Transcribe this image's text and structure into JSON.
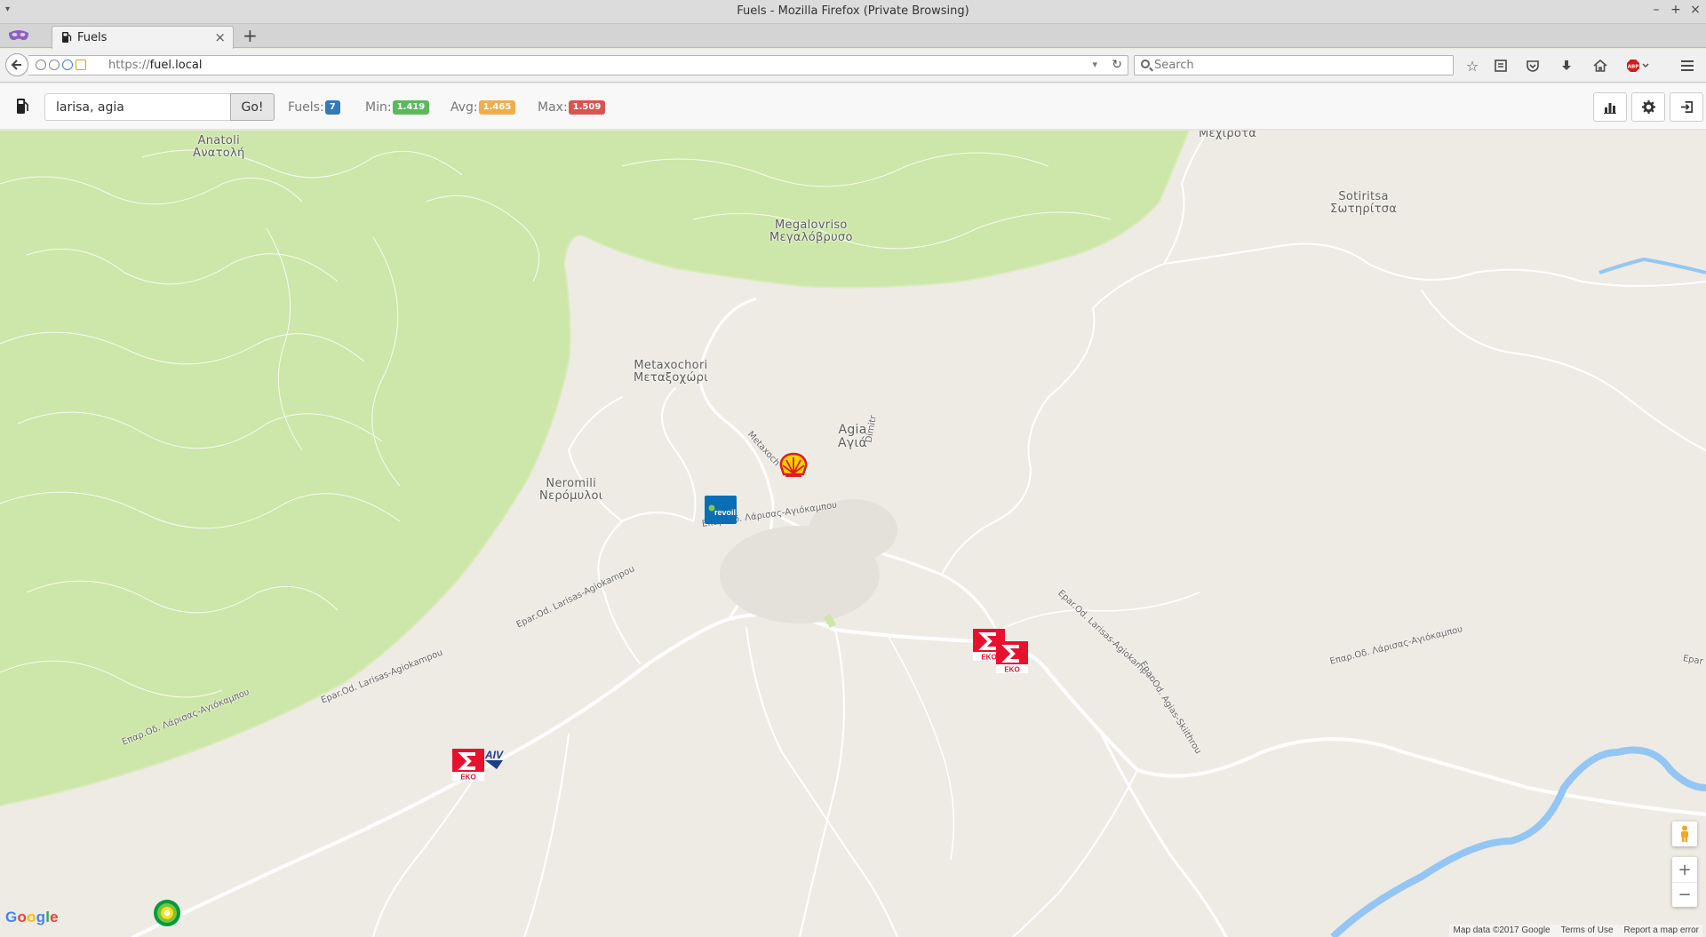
{
  "window": {
    "title": "Fuels - Mozilla Firefox (Private Browsing)"
  },
  "tab": {
    "label": "Fuels",
    "close_glyph": "×",
    "new_tab_glyph": "+"
  },
  "urlbar": {
    "scheme": "https://",
    "host": "fuel.local"
  },
  "searchbar": {
    "placeholder": "Search"
  },
  "app": {
    "location_value": "larisa, agia",
    "go_label": "Go!",
    "stats": {
      "fuels_label": "Fuels:",
      "fuels_count": "7",
      "min_label": "Min:",
      "min_value": "1.419",
      "avg_label": "Avg:",
      "avg_value": "1.465",
      "max_label": "Max:",
      "max_value": "1.509"
    },
    "actions": [
      "bar-chart-icon",
      "gear-icon",
      "sign-out-icon"
    ]
  },
  "map": {
    "places": {
      "mexrota": "Μεχίροτα",
      "anatoli_latin": "Anatoli",
      "anatoli_greek": "Ανατολή",
      "sotiritsa_latin": "Sotiritsa",
      "sotiritsa_greek": "Σωτηρίτσα",
      "megalovriso_latin": "Megalovriso",
      "megalovriso_greek": "Μεγαλόβρυσο",
      "metaxochori_latin": "Metaxochori",
      "metaxochori_greek": "Μεταξοχώρι",
      "agia_latin": "Agia",
      "agia_greek": "Αγιά",
      "neromili_latin": "Neromili",
      "neromili_greek": "Νερόμυλοι"
    },
    "roads": {
      "r1": "Επαρ.Οδ. Λάρισας-Αγιόκαμπου",
      "r2": "Epar.Od. Larisas-Agiokampou",
      "r3": "Epar.Od. Larisas-Agiokampou",
      "r4": "Επαρ.Οδ. Λάρισας-Αγιόκαμπου",
      "r5": "Epar.Od. Larisas-Agiokampou",
      "r6": "Epar.Od. Agias-Skiithrou",
      "r7": "Επαρ.Οδ. Λάρισας-Αγιόκαμπου",
      "r8": "Epar",
      "r9": "Metaxoch",
      "r10": "Dimitr"
    },
    "stations": [
      {
        "brand": "Shell"
      },
      {
        "brand": "revoil"
      },
      {
        "brand": "EKO"
      },
      {
        "brand": "EKO"
      },
      {
        "brand": "EKO"
      },
      {
        "brand": "AIV"
      },
      {
        "brand": "BP"
      }
    ],
    "zoom_in": "+",
    "zoom_out": "−",
    "logo": "Google",
    "attribution": {
      "data": "Map data ©2017 Google",
      "terms": "Terms of Use",
      "report": "Report a map error"
    },
    "colors": {
      "land": "#eeebe4",
      "forest": "#cde6a9",
      "water": "#94c6f5",
      "road": "#ffffff"
    }
  }
}
